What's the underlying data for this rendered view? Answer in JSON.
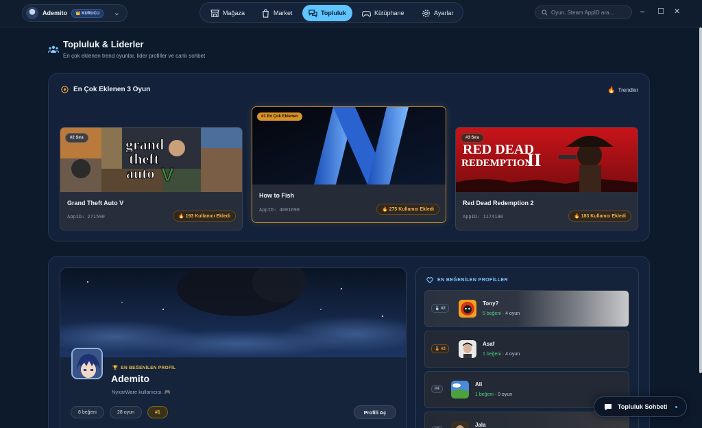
{
  "user": {
    "name": "Ademito",
    "badge": "👑 KURUCU"
  },
  "nav": {
    "items": [
      {
        "label": "Mağaza"
      },
      {
        "label": "Market"
      },
      {
        "label": "Topluluk"
      },
      {
        "label": "Kütüphane"
      },
      {
        "label": "Ayarlar"
      }
    ],
    "active": "Topluluk"
  },
  "search": {
    "placeholder": "Oyun, Steam AppID ara..."
  },
  "page": {
    "title": "Topluluk & Liderler",
    "subtitle": "En çok eklenen trend oyunlar, lider profiller ve canlı sohbet"
  },
  "trending": {
    "title": "En Çok Eklenen 3 Oyun",
    "link": "Trendler",
    "games": [
      {
        "rank_label": "#2 Sıra",
        "name": "Grand Theft Auto V",
        "appid": "AppID: 271590",
        "count": "193 Kullanıcı Ekledi"
      },
      {
        "rank_label": "#1 En Çok Eklenen",
        "name": "How to Fish",
        "appid": "AppID: 4001690",
        "count": "275 Kullanıcı Ekledi"
      },
      {
        "rank_label": "#3 Sıra",
        "name": "Red Dead Redemption 2",
        "appid": "AppID: 1174180",
        "count": "183 Kullanıcı Ekledi"
      }
    ]
  },
  "featured": {
    "badge": "EN BEĞENİLEN PROFİL",
    "name": "Ademito",
    "desc": "NyxarWare kullanıcısı. 🎮",
    "likes": "8 beğeni",
    "games": "28 oyun",
    "rank": "#1",
    "open_label": "Profili Aç"
  },
  "liked": {
    "title": "EN BEĞENİLEN PROFİLLER",
    "profiles": [
      {
        "rank": "#2",
        "name": "Tony?",
        "likes": "5 beğeni",
        "games": "4 oyun"
      },
      {
        "rank": "#3",
        "name": "Asaf",
        "likes": "1 beğeni",
        "games": "4 oyun"
      },
      {
        "rank": "#4",
        "name": "Ali",
        "likes": "1 beğeni",
        "games": "0 oyun"
      },
      {
        "rank": "#5",
        "name": "Jala",
        "likes": "",
        "games": ""
      }
    ]
  },
  "chat": {
    "label": "Topluluk Sohbeti"
  },
  "colors": {
    "accent": "#5fc4ff",
    "gold": "#d9932b",
    "like_green": "#4fd07f"
  }
}
